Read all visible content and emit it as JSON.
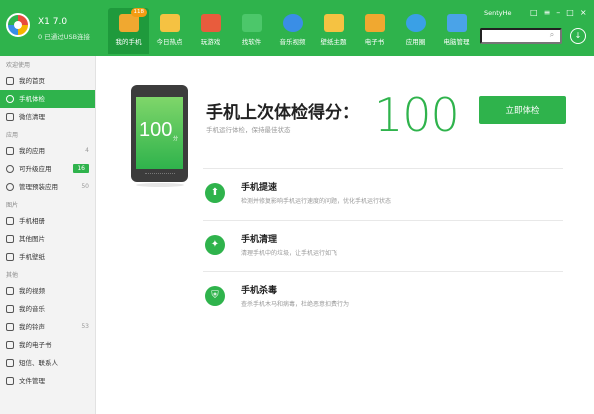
{
  "app": {
    "title": "X1 7.0",
    "subtitle": "0 已通过USB连接",
    "user": "SentyHe"
  },
  "header": {
    "nav": [
      {
        "label": "我的手机",
        "badge": "118",
        "icon": "phone-icon",
        "color": "#f0a830"
      },
      {
        "label": "今日热点",
        "icon": "star-icon",
        "color": "#f5c242"
      },
      {
        "label": "玩游戏",
        "icon": "game-icon",
        "color": "#e85c3d"
      },
      {
        "label": "找软件",
        "icon": "apps-icon",
        "color": "#4cc76a"
      },
      {
        "label": "音乐视频",
        "icon": "play-icon",
        "color": "#3a8ee6"
      },
      {
        "label": "壁纸主题",
        "icon": "wallpaper-icon",
        "color": "#f5c242"
      },
      {
        "label": "电子书",
        "icon": "book-icon",
        "color": "#f0a830"
      },
      {
        "label": "应用圈",
        "icon": "circle-icon",
        "color": "#3aa0e6"
      },
      {
        "label": "电脑管理",
        "icon": "computer-icon",
        "color": "#4aa3e8"
      }
    ],
    "search_placeholder": "",
    "win_controls": [
      "□",
      "≡",
      "–",
      "□",
      "×"
    ]
  },
  "sidebar": {
    "sections": [
      {
        "title": "欢迎使用",
        "items": [
          {
            "label": "我的首页",
            "count": ""
          },
          {
            "label": "手机体检",
            "count": "",
            "active": true
          },
          {
            "label": "微信清理",
            "count": ""
          }
        ]
      },
      {
        "title": "应用",
        "items": [
          {
            "label": "我的应用",
            "count": "4"
          },
          {
            "label": "可升级应用",
            "count": "16",
            "green": true
          },
          {
            "label": "管理预装应用",
            "count": "50"
          }
        ]
      },
      {
        "title": "图片",
        "items": [
          {
            "label": "手机相册",
            "count": ""
          },
          {
            "label": "其他图片",
            "count": ""
          },
          {
            "label": "手机壁纸",
            "count": ""
          }
        ]
      },
      {
        "title": "其他",
        "items": [
          {
            "label": "我的视频",
            "count": ""
          },
          {
            "label": "我的音乐",
            "count": ""
          },
          {
            "label": "我的铃声",
            "count": "53"
          },
          {
            "label": "我的电子书",
            "count": ""
          },
          {
            "label": "短信、联系人",
            "count": ""
          },
          {
            "label": "文件管理",
            "count": ""
          }
        ]
      }
    ]
  },
  "main": {
    "phone_score": "100",
    "phone_unit": "分",
    "score_title": "手机上次体检得分：",
    "score_sub": "手机运行体检，保持最佳状态",
    "score_value": "100",
    "check_button": "立即体检",
    "features": [
      {
        "title": "手机提速",
        "desc": "检测并修复影响手机运行速度的问题，优化手机运行状态",
        "icon": "rocket-icon"
      },
      {
        "title": "手机清理",
        "desc": "清理手机中的垃圾，让手机运行如飞",
        "icon": "broom-icon"
      },
      {
        "title": "手机杀毒",
        "desc": "查杀手机木马和病毒，杜绝恶意扣费行为",
        "icon": "shield-icon"
      }
    ]
  },
  "colors": {
    "brand": "#2fb34c",
    "brand_dark": "#1f9a3c"
  }
}
